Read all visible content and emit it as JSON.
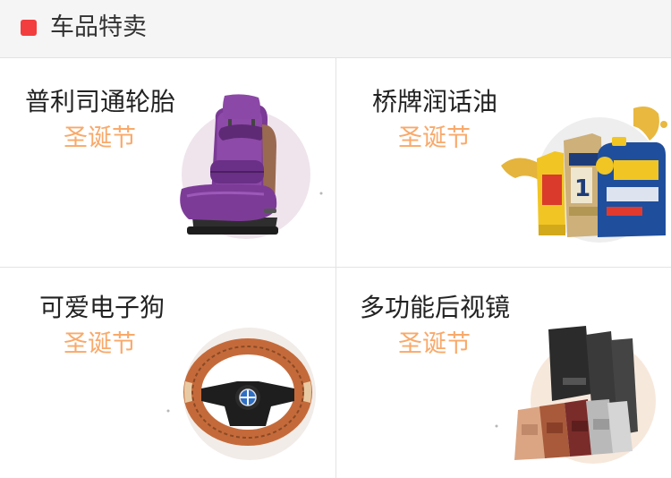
{
  "header": {
    "title": "车品特卖",
    "accent_color": "#f23e3e"
  },
  "colors": {
    "name_text": "#222222",
    "promo_text": "#f9a96a",
    "divider": "#e3e3e3",
    "header_bg": "#f5f5f5"
  },
  "products": [
    {
      "name": "普利司通轮胎",
      "promo": "圣诞节",
      "image": "purple-car-seat-cover-image"
    },
    {
      "name": "桥牌润话油",
      "promo": "圣诞节",
      "image": "engine-oil-bottles-image"
    },
    {
      "name": "可爱电子狗",
      "promo": "圣诞节",
      "image": "steering-wheel-cover-image"
    },
    {
      "name": "多功能后视镜",
      "promo": "圣诞节",
      "image": "car-floor-mats-image"
    }
  ]
}
